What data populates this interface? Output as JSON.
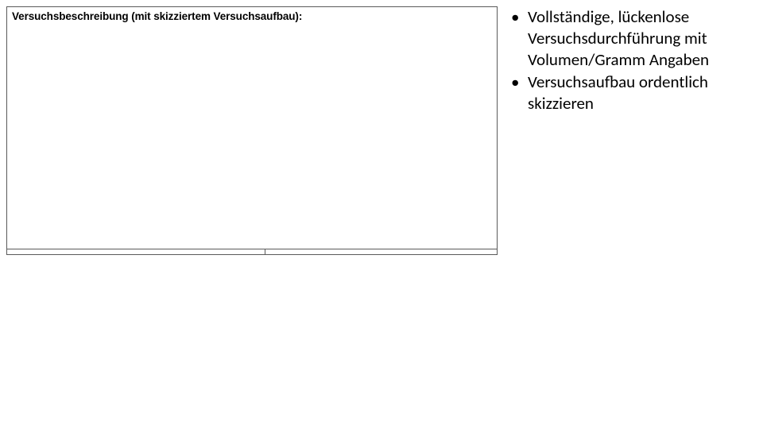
{
  "box": {
    "label": "Versuchsbeschreibung (mit skizziertem Versuchsaufbau):"
  },
  "bullets": {
    "items": [
      "Vollständige, lückenlose Versuchsdurchführung mit Volumen/Gramm Angaben",
      "Versuchsaufbau ordentlich skizzieren"
    ]
  }
}
